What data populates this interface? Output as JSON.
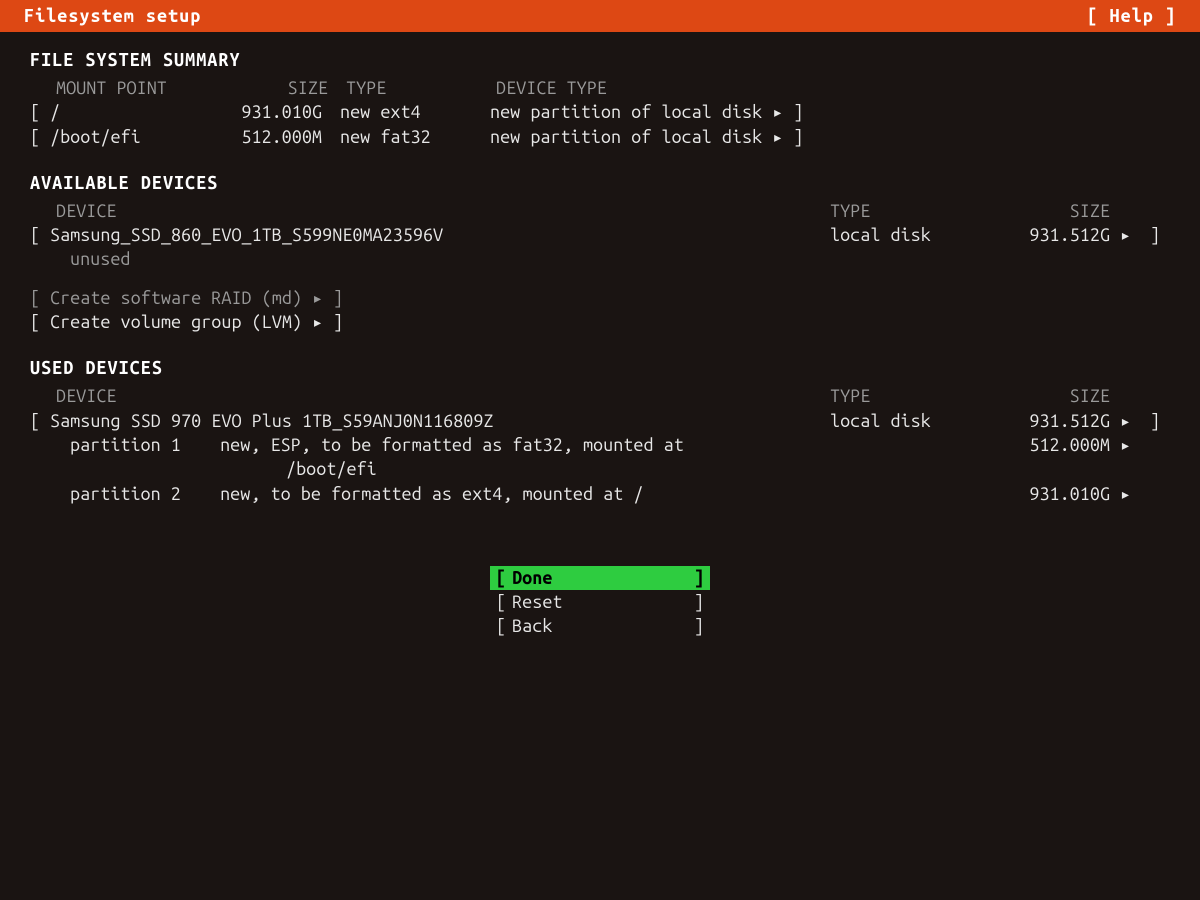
{
  "titlebar": {
    "title": "Filesystem setup",
    "help": "[ Help ]"
  },
  "fs_summary": {
    "heading": "FILE SYSTEM SUMMARY",
    "headers": {
      "mount": "MOUNT POINT",
      "size": "SIZE",
      "type": "TYPE",
      "device_type": "DEVICE TYPE"
    },
    "rows": [
      {
        "mount": "/",
        "size": "931.010G",
        "type": "new ext4",
        "device_type": "new partition of local disk"
      },
      {
        "mount": "/boot/efi",
        "size": "512.000M",
        "type": "new fat32",
        "device_type": "new partition of local disk"
      }
    ]
  },
  "available": {
    "heading": "AVAILABLE DEVICES",
    "headers": {
      "device": "DEVICE",
      "type": "TYPE",
      "size": "SIZE"
    },
    "devices": [
      {
        "name": "Samsung_SSD_860_EVO_1TB_S599NE0MA23596V",
        "type": "local disk",
        "size": "931.512G",
        "note": "unused"
      }
    ],
    "actions": [
      "Create software RAID (md)",
      "Create volume group (LVM)"
    ]
  },
  "used": {
    "heading": "USED DEVICES",
    "headers": {
      "device": "DEVICE",
      "type": "TYPE",
      "size": "SIZE"
    },
    "devices": [
      {
        "name": "Samsung SSD 970 EVO Plus 1TB_S59ANJ0N116809Z",
        "type": "local disk",
        "size": "931.512G",
        "partitions": [
          {
            "label": "partition 1",
            "desc": "new, ESP, to be formatted as fat32, mounted at",
            "desc2": "/boot/efi",
            "size": "512.000M"
          },
          {
            "label": "partition 2",
            "desc": "new, to be formatted as ext4, mounted at /",
            "desc2": "",
            "size": "931.010G"
          }
        ]
      }
    ]
  },
  "buttons": {
    "done": "Done",
    "reset": "Reset",
    "back": "Back"
  },
  "glyphs": {
    "open": "[",
    "close": "]",
    "caret": "▸"
  }
}
